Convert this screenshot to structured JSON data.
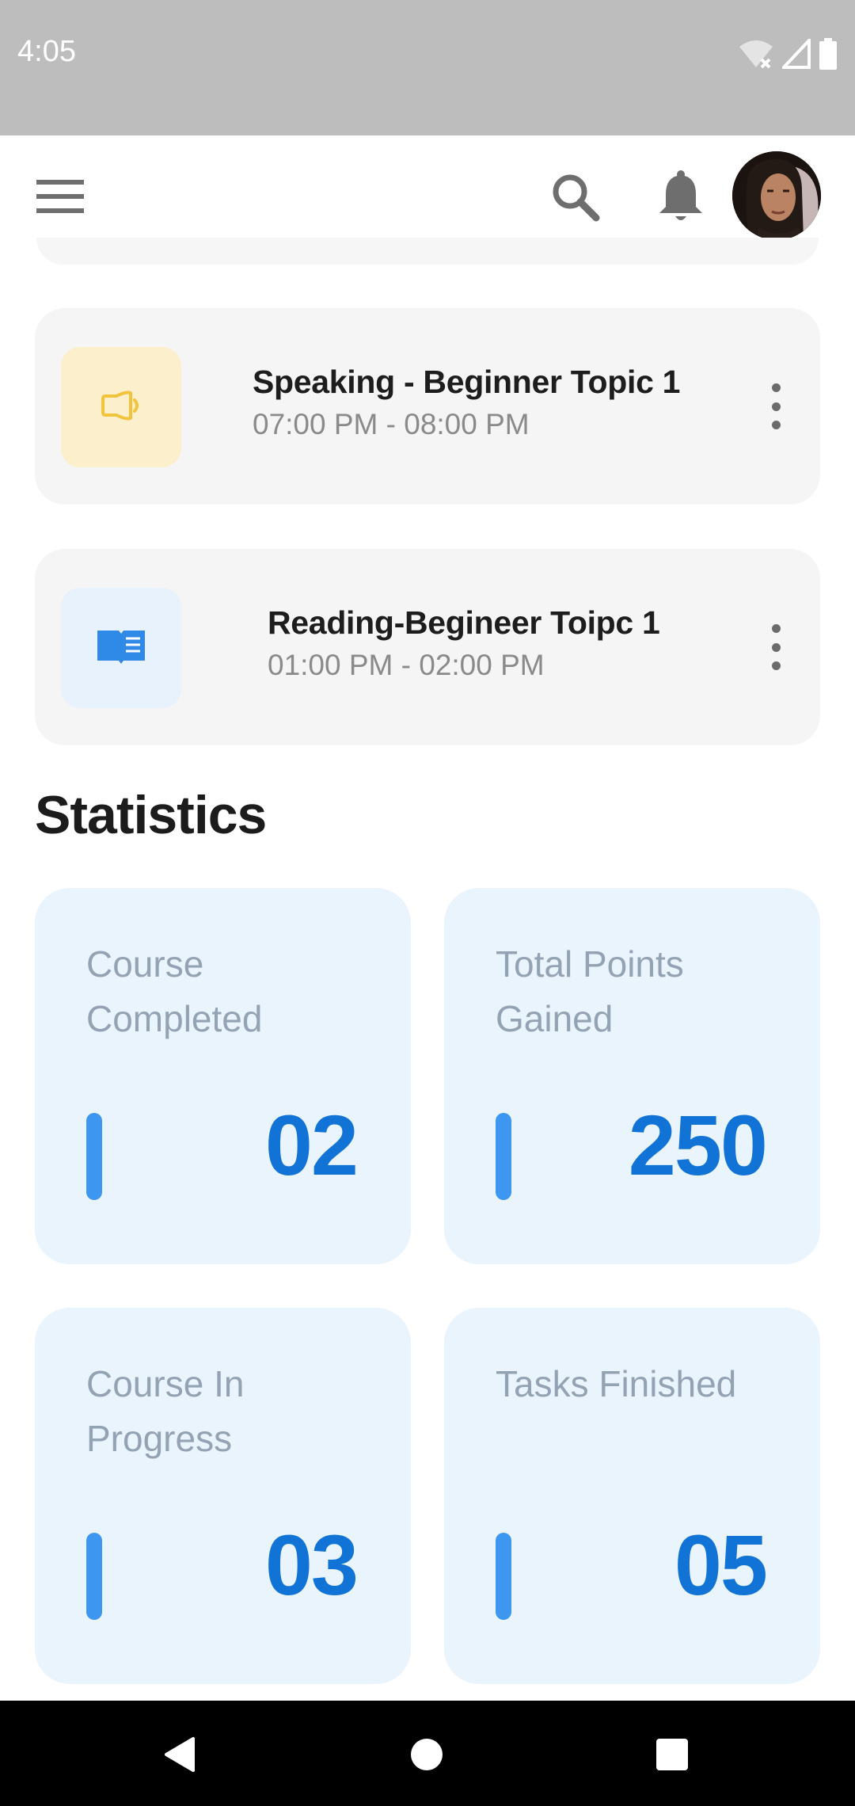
{
  "status_bar": {
    "time": "4:05",
    "icons": [
      "wifi-off-icon",
      "signal-icon",
      "battery-icon"
    ]
  },
  "app_bar": {
    "icons": [
      "menu-icon",
      "search-icon",
      "bell-icon",
      "avatar"
    ]
  },
  "schedule": [
    {
      "title": "Speaking - Beginner Topic 1",
      "time": "07:00 PM - 08:00 PM",
      "icon": "speaker-icon",
      "tile_color": "#fbefcc",
      "icon_color": "#f2c43d"
    },
    {
      "title": "Reading-Begineer Toipc 1",
      "time": "01:00 PM - 02:00 PM",
      "icon": "book-icon",
      "tile_color": "#e8f2fd",
      "icon_color": "#2f89e6"
    }
  ],
  "statistics": {
    "title": "Statistics",
    "cards": [
      {
        "label": "Course Completed",
        "value": "02"
      },
      {
        "label": "Total Points Gained",
        "value": "250"
      },
      {
        "label": "Course In Progress",
        "value": "03"
      },
      {
        "label": "Tasks Finished",
        "value": "05"
      }
    ]
  },
  "colors": {
    "accent": "#1273d6",
    "accent_bar": "#3d96ef",
    "stat_card_bg": "#eaf4fd",
    "status_bar_bg": "#bdbdbd"
  }
}
